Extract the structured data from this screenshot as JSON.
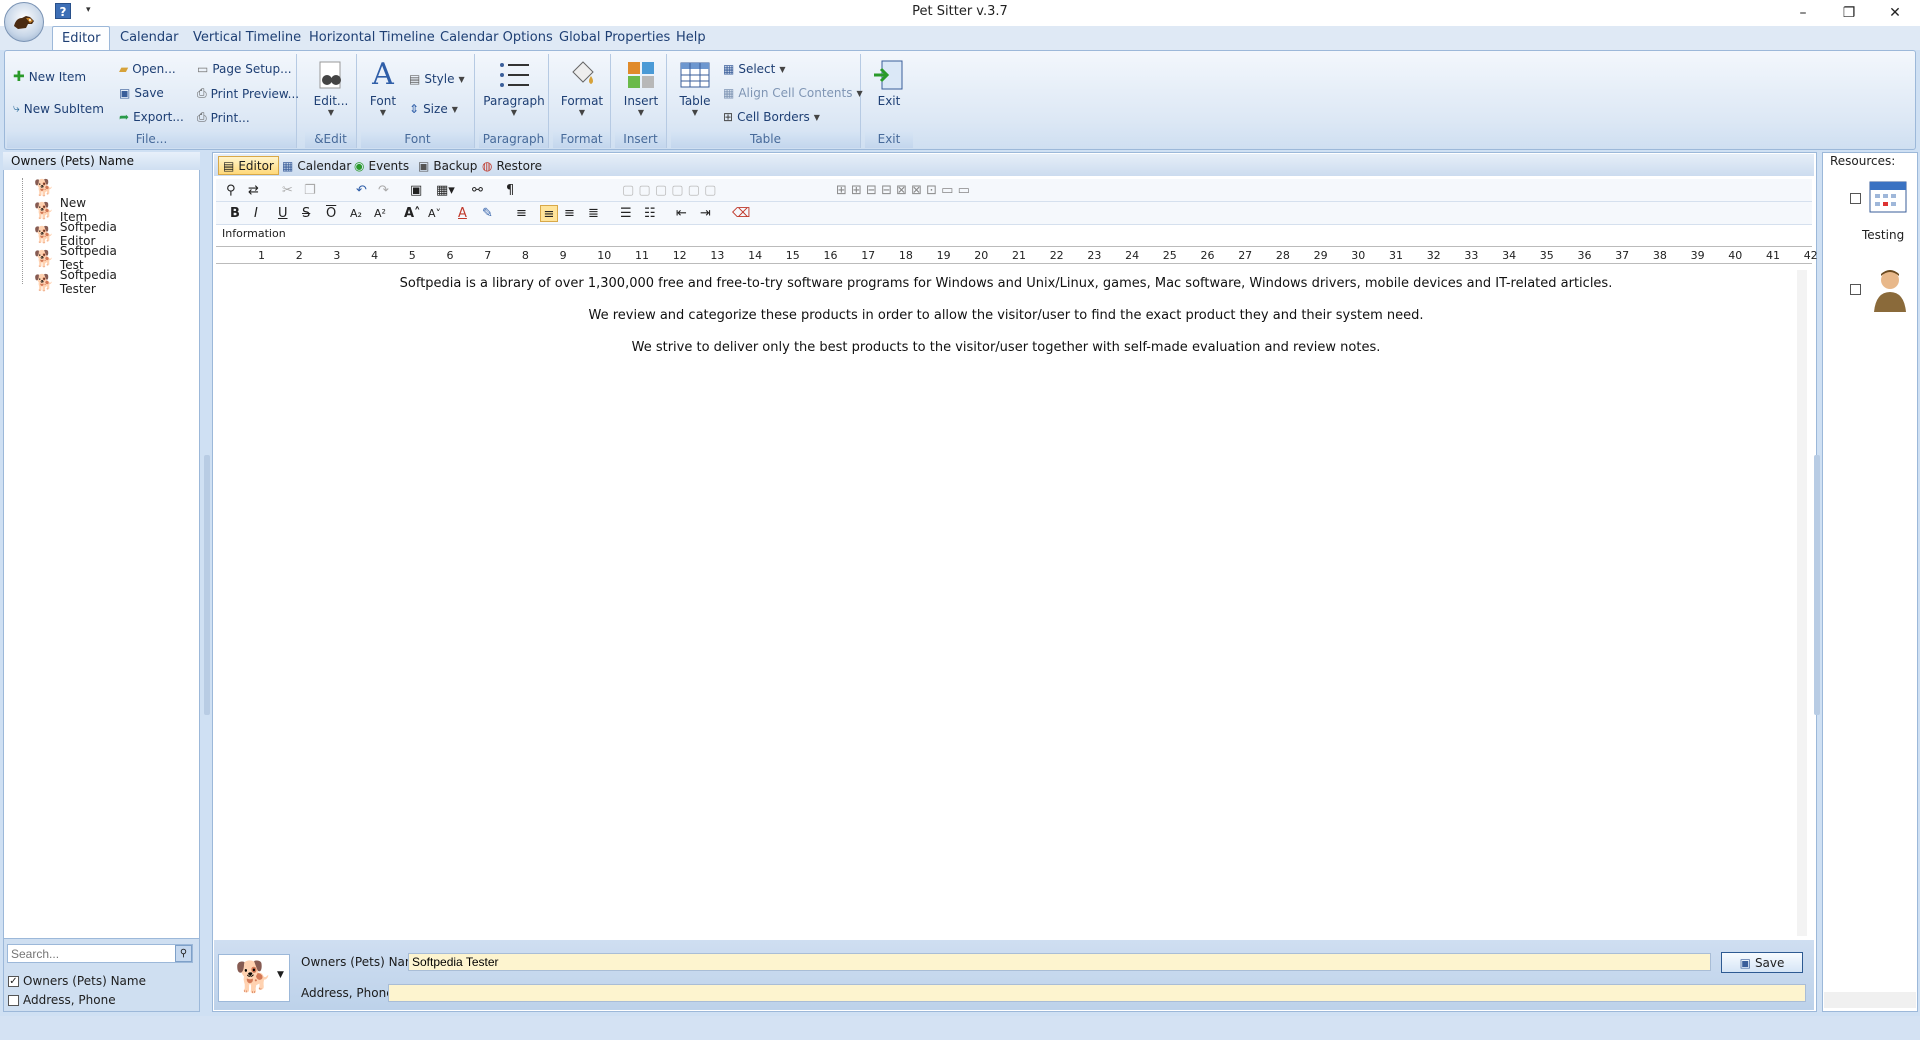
{
  "window": {
    "title": "Pet Sitter v.3.7",
    "minimize": "–",
    "maximize": "❐",
    "close": "✕"
  },
  "qat": {
    "help": "?",
    "more": "▾"
  },
  "menu": [
    "Editor",
    "Calendar",
    "Vertical Timeline",
    "Horizontal Timeline",
    "Calendar Options",
    "Global Properties",
    "Help"
  ],
  "ribbon": {
    "new_item": "New Item",
    "new_subitem": "New SubItem",
    "open": "Open...",
    "save": "Save",
    "export": "Export...",
    "page_setup": "Page Setup...",
    "print_preview": "Print Preview...",
    "print": "Print...",
    "file_caption": "File...",
    "edit": "Edit...",
    "edit_caption": "&Edit",
    "font": "Font",
    "style": "Style",
    "size": "Size",
    "font_caption": "Font",
    "paragraph": "Paragraph",
    "paragraph_caption": "Paragraph",
    "format": "Format",
    "format_caption": "Format",
    "insert": "Insert",
    "insert_caption": "Insert",
    "table": "Table",
    "select": "Select",
    "align_cell": "Align Cell Contents",
    "cell_borders": "Cell Borders",
    "table_caption": "Table",
    "exit": "Exit",
    "exit_caption": "Exit"
  },
  "left": {
    "header": "Owners (Pets) Name",
    "items": [
      "",
      "New Item",
      "Softpedia Editor",
      "Softpedia Test",
      "Softpedia Tester"
    ],
    "search_placeholder": "Search...",
    "chk1": "Owners (Pets) Name",
    "chk1_checked": "✓",
    "chk2": "Address, Phone"
  },
  "subtabs": [
    "Editor",
    "Calendar",
    "Events",
    "Backup",
    "Restore"
  ],
  "editor": {
    "info_label": "Information",
    "ruler": [
      "1",
      "2",
      "3",
      "4",
      "5",
      "6",
      "7",
      "8",
      "9",
      "10",
      "11",
      "12",
      "13",
      "14",
      "15",
      "16",
      "17",
      "18",
      "19",
      "20",
      "21",
      "22",
      "23",
      "24",
      "25",
      "26",
      "27",
      "28",
      "29",
      "30",
      "31",
      "32",
      "33",
      "34",
      "35",
      "36",
      "37",
      "38",
      "39",
      "40",
      "41",
      "42"
    ],
    "paragraphs": [
      "Softpedia is a library of over 1,300,000 free and free-to-try software programs for Windows and Unix/Linux, games, Mac software, Windows drivers, mobile devices and IT-related articles.",
      "We review and categorize these products in order to allow the visitor/user to find the exact product they and their system need.",
      "We strive to deliver only the best products to the visitor/user together with self-made evaluation and review notes."
    ]
  },
  "form": {
    "name_label": "Owners (Pets) Name:",
    "name_value": "Softpedia Tester",
    "address_label": "Address, Phone:",
    "address_value": "",
    "save": "Save"
  },
  "resources": {
    "header": "Resources:",
    "item1": "Testing"
  },
  "colors": {
    "accent": "#1e3f74",
    "ribbon": "#dde8f5",
    "input_bg": "#fdf4cf"
  }
}
